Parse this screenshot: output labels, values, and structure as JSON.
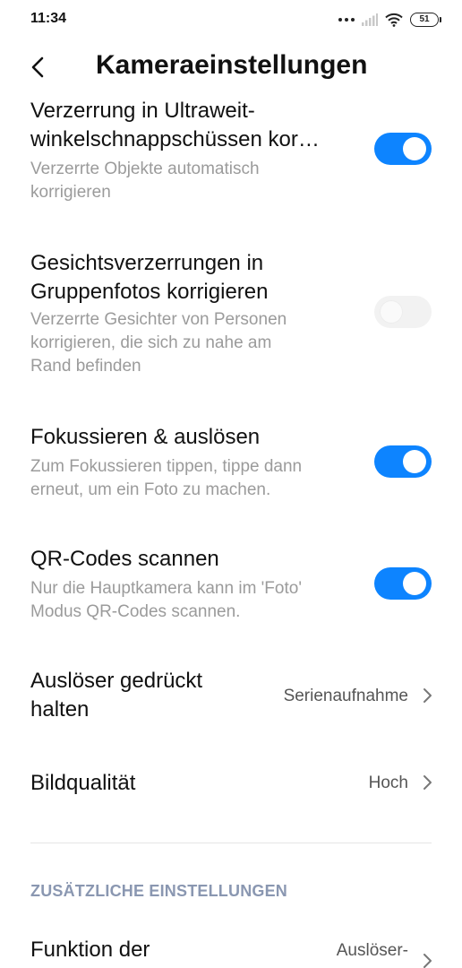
{
  "status_bar": {
    "time": "11:34",
    "battery": "51",
    "icons": [
      "more-dots-icon",
      "signal-icon",
      "wifi-icon",
      "battery-icon"
    ]
  },
  "header": {
    "title": "Kameraeinstellungen",
    "back_icon": "back-arrow-icon"
  },
  "settings": [
    {
      "title_lines": [
        "Verzerrung in Ultraweit-",
        "winkelschnappschüssen kor…"
      ],
      "desc_lines": [
        "Verzerrte Objekte automatisch",
        "korrigieren"
      ],
      "toggle": "on"
    },
    {
      "title_lines": [
        "Gesichtsverzerrungen in",
        "Gruppenfotos korrigieren"
      ],
      "desc_lines": [
        "Verzerrte Gesichter von Personen",
        "korrigieren, die sich zu nahe am",
        "Rand befinden"
      ],
      "toggle": "off"
    },
    {
      "title_lines": [
        "Fokussieren & auslösen"
      ],
      "desc_lines": [
        "Zum Fokussieren tippen, tippe dann",
        "erneut, um ein Foto zu machen."
      ],
      "toggle": "on"
    },
    {
      "title_lines": [
        "QR-Codes scannen"
      ],
      "desc_lines": [
        "Nur die Hauptkamera kann im 'Foto'",
        "Modus QR-Codes scannen."
      ],
      "toggle": "on"
    }
  ],
  "nav_rows": [
    {
      "title_lines": [
        "Auslöser gedrückt",
        "halten"
      ],
      "value": "Serienaufnahme"
    },
    {
      "title_lines": [
        "Bildqualität"
      ],
      "value": "Hoch"
    },
    {
      "title_lines": [
        "Funktion der"
      ],
      "value": "Auslöser-"
    }
  ],
  "section": {
    "header": "ZUSÄTZLICHE EINSTELLUNGEN"
  },
  "colors": {
    "accent": "#0d84ff",
    "toggle_off": "#f2f2f2",
    "secondary_text": "#9b9b9b",
    "section_header": "#8a97b1"
  }
}
